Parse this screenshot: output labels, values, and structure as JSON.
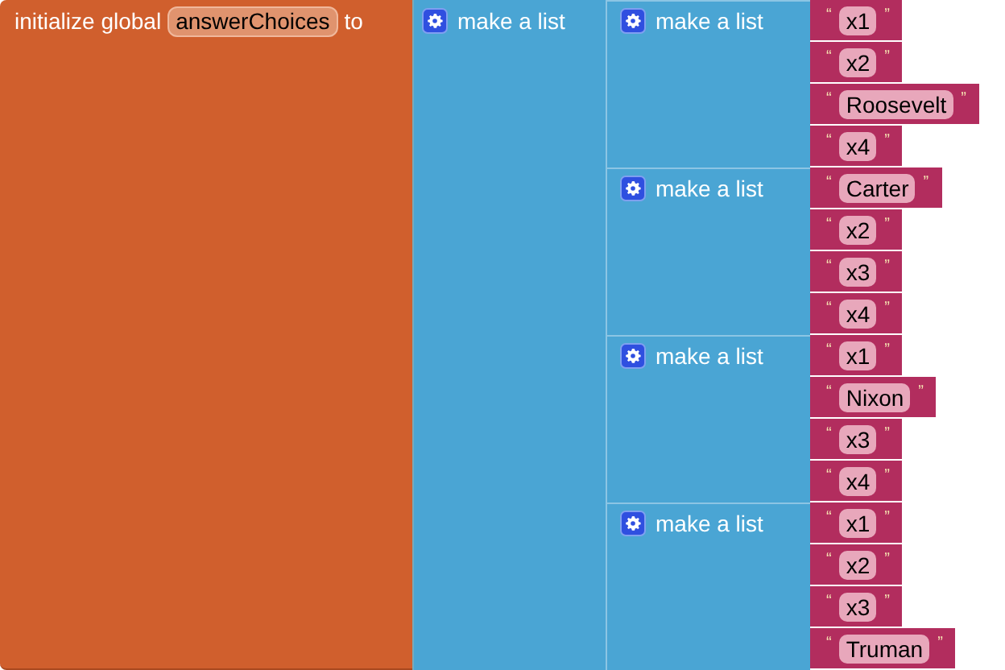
{
  "init_block": {
    "label": "initialize global",
    "variable": "answerChoices",
    "suffix": "to"
  },
  "outer_list": {
    "label": "make a list"
  },
  "lists": [
    {
      "label": "make a list",
      "items": [
        {
          "open": "“",
          "value": "x1",
          "close": "”"
        },
        {
          "open": "“",
          "value": "x2",
          "close": "”"
        },
        {
          "open": "“",
          "value": "Roosevelt",
          "close": "”"
        },
        {
          "open": "“",
          "value": "x4",
          "close": "”"
        }
      ]
    },
    {
      "label": "make a list",
      "items": [
        {
          "open": "“",
          "value": "Carter",
          "close": "”"
        },
        {
          "open": "“",
          "value": "x2",
          "close": "”"
        },
        {
          "open": "“",
          "value": "x3",
          "close": "”"
        },
        {
          "open": "“",
          "value": "x4",
          "close": "”"
        }
      ]
    },
    {
      "label": "make a list",
      "items": [
        {
          "open": "“",
          "value": "x1",
          "close": "”"
        },
        {
          "open": "“",
          "value": "Nixon",
          "close": "”"
        },
        {
          "open": "“",
          "value": "x3",
          "close": "”"
        },
        {
          "open": "“",
          "value": "x4",
          "close": "”"
        }
      ]
    },
    {
      "label": "make a list",
      "items": [
        {
          "open": "“",
          "value": "x1",
          "close": "”"
        },
        {
          "open": "“",
          "value": "x2",
          "close": "”"
        },
        {
          "open": "“",
          "value": "x3",
          "close": "”"
        },
        {
          "open": "“",
          "value": "Truman",
          "close": "”"
        }
      ]
    }
  ]
}
